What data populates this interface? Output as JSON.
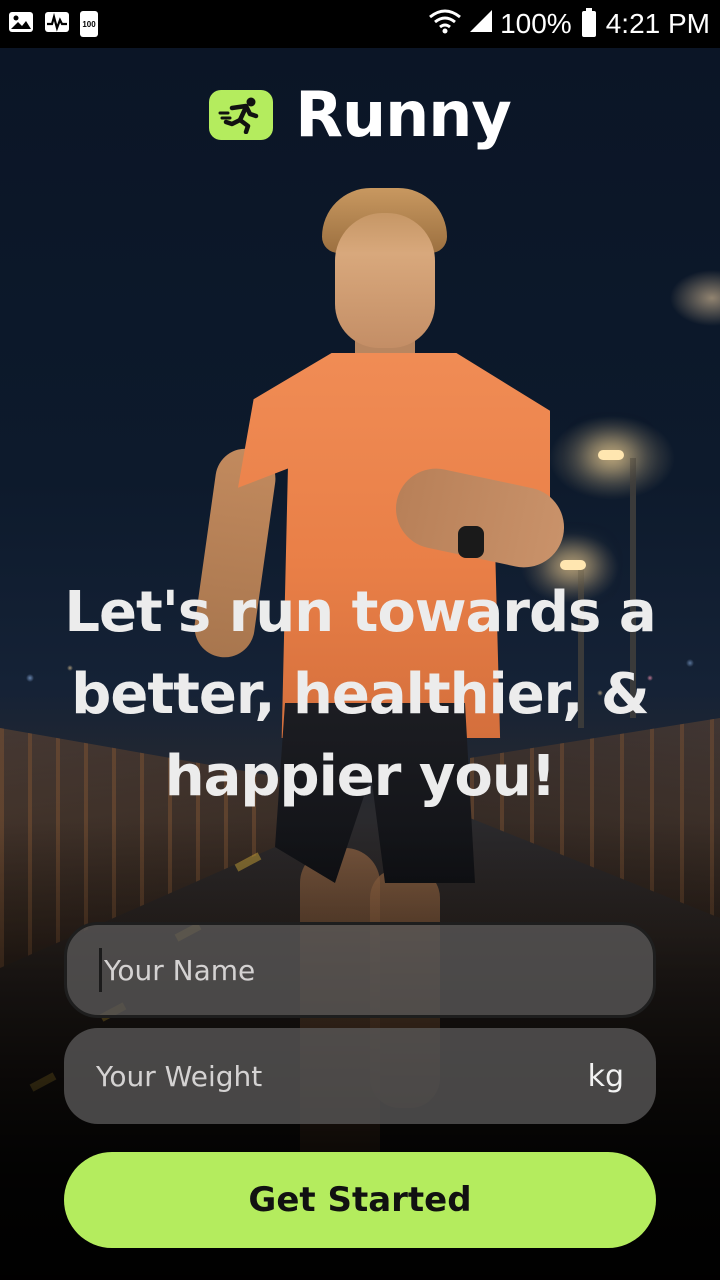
{
  "status_bar": {
    "battery_badge": "100",
    "battery_percent": "100%",
    "time": "4:21 PM"
  },
  "brand": {
    "name": "Runny",
    "accent_color": "#b4ec5e",
    "icon": "runner-icon"
  },
  "headline": {
    "line1": "Let's run towards a",
    "line2": "better, healthier, &",
    "line3": "happier you!"
  },
  "form": {
    "name_placeholder": "Your Name",
    "name_value": "",
    "weight_placeholder": "Your Weight",
    "weight_value": "",
    "weight_unit": "kg"
  },
  "cta": {
    "label": "Get Started"
  }
}
